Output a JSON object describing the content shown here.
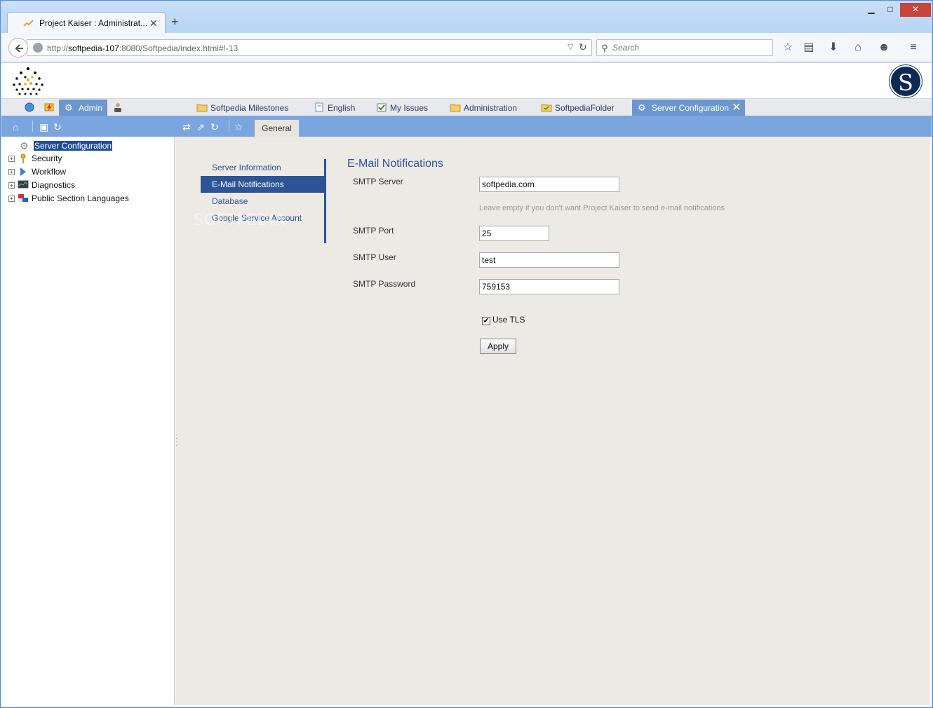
{
  "browser": {
    "tab_title": "Project Kaiser : Administrat...",
    "new_tab": "+",
    "url_prefix": "http://",
    "url_host": "softpedia-107",
    "url_rest": ":8080/Softpedia/index.html#!-13",
    "search_placeholder": "Search",
    "controls": {
      "minimize": "▁",
      "maximize": "□",
      "close": "✕"
    }
  },
  "app_tabs": {
    "admin": "Admin",
    "tabs": [
      "Softpedia Milestones",
      "English",
      "My Issues",
      "Administration",
      "SoftpediaFolder",
      "Server Configuration"
    ]
  },
  "toolbar": {
    "general_tab": "General"
  },
  "tree": {
    "items": [
      {
        "label": "Server Configuration",
        "selected": true
      },
      {
        "label": "Security"
      },
      {
        "label": "Workflow"
      },
      {
        "label": "Diagnostics"
      },
      {
        "label": "Public Section Languages"
      }
    ]
  },
  "settings_nav": {
    "items": [
      "Server Information",
      "E-Mail Notifications",
      "Database",
      "Google Service Account"
    ],
    "active": "E-Mail Notifications"
  },
  "watermark": "SOFTPEDIA",
  "form": {
    "title": "E-Mail Notifications",
    "smtp_server_label": "SMTP Server",
    "smtp_server_value": "softpedia.com",
    "smtp_server_hint": "Leave empty if you don't want Project Kaiser to send e-mail notifications",
    "smtp_port_label": "SMTP Port",
    "smtp_port_value": "25",
    "smtp_user_label": "SMTP User",
    "smtp_user_value": "test",
    "smtp_password_label": "SMTP Password",
    "smtp_password_value": "759153",
    "use_tls_label": "Use TLS",
    "use_tls_checked": true,
    "apply_label": "Apply"
  },
  "colors": {
    "accent": "#2d5596",
    "toolbar": "#7aa5df",
    "selected": "#1f4e95"
  }
}
